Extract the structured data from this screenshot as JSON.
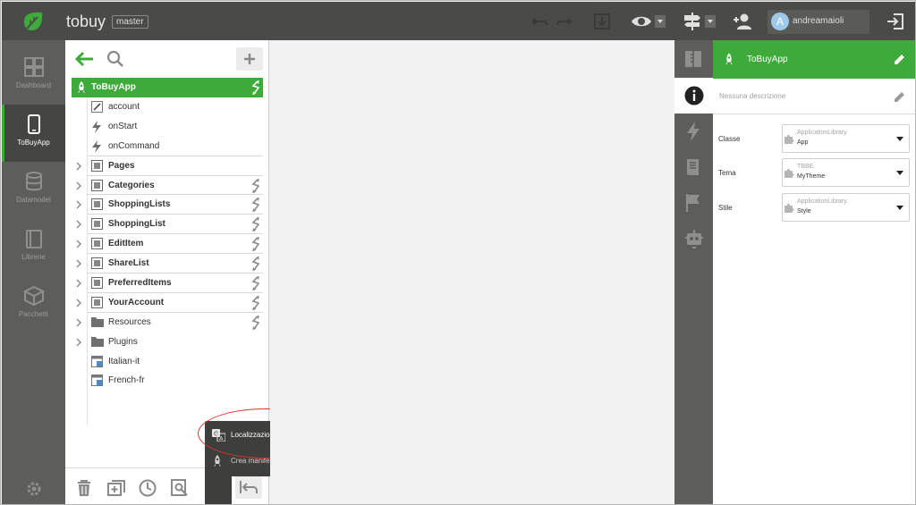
{
  "topbar": {
    "app_name": "tobuy",
    "branch": "master",
    "user": {
      "initial": "A",
      "name": "andreamaioli"
    }
  },
  "leftnav": {
    "items": [
      {
        "label": "Dashboard",
        "icon": "dashboard-icon"
      },
      {
        "label": "ToBuyApp",
        "icon": "phone-icon",
        "active": true
      },
      {
        "label": "Datamodel",
        "icon": "database-icon"
      },
      {
        "label": "Librerie",
        "icon": "library-icon"
      },
      {
        "label": "Pacchetti",
        "icon": "package-icon"
      }
    ]
  },
  "tree": {
    "root": "ToBuyApp",
    "children": [
      "account",
      "onStart",
      "onCommand"
    ],
    "items": [
      {
        "label": "Pages",
        "bold": true,
        "sync": false
      },
      {
        "label": "Categories",
        "bold": true,
        "sync": true
      },
      {
        "label": "ShoppingLists",
        "bold": true,
        "sync": true
      },
      {
        "label": "ShoppingList",
        "bold": true,
        "sync": true
      },
      {
        "label": "EditItem",
        "bold": true,
        "sync": true
      },
      {
        "label": "ShareList",
        "bold": true,
        "sync": true
      },
      {
        "label": "PreferredItems",
        "bold": true,
        "sync": true
      },
      {
        "label": "YourAccount",
        "bold": true,
        "sync": true
      },
      {
        "label": "Resources",
        "bold": false,
        "sync": true
      },
      {
        "label": "Plugins",
        "bold": false,
        "sync": false
      },
      {
        "label": "Italian-it",
        "bold": false,
        "sync": false
      },
      {
        "label": "French-fr",
        "bold": false,
        "sync": false
      }
    ]
  },
  "popup": {
    "item1": "Localizzazione",
    "item2": "Crea manifest per PWA"
  },
  "props": {
    "title": "ToBuyApp",
    "description": "Nessuna descrizione",
    "rows": [
      {
        "label": "Classe",
        "ns": "ApplicationLibrary.",
        "value": "App"
      },
      {
        "label": "Tema",
        "ns": "TBBE.",
        "value": "MyTheme"
      },
      {
        "label": "Stile",
        "ns": "ApplicationLibrary.",
        "value": "Style"
      }
    ]
  },
  "colors": {
    "accent": "#3daa3a",
    "topbar": "#4a4b49",
    "nav": "#5d5e5c",
    "highlight": "#d9362a"
  }
}
